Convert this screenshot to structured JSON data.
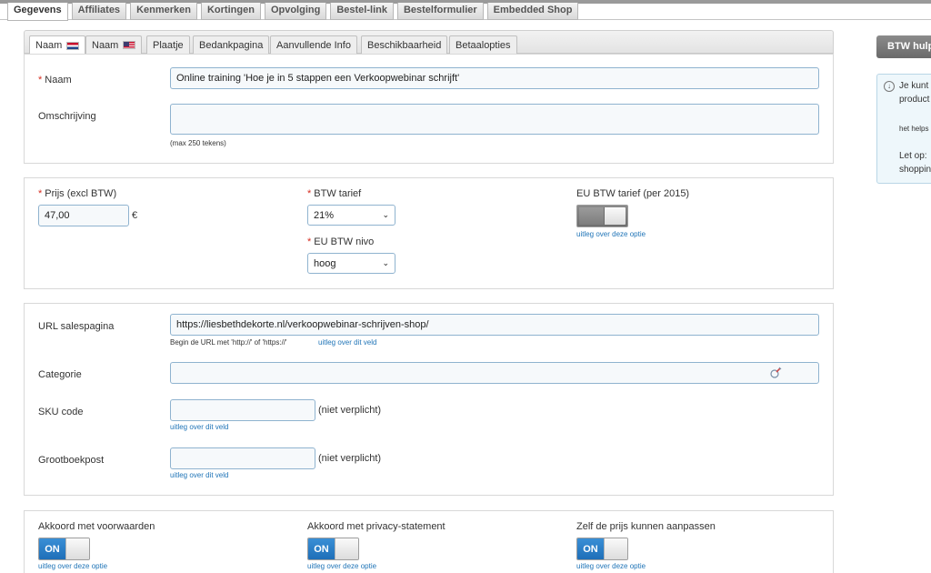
{
  "main_tabs": [
    "Gegevens",
    "Affiliates",
    "Kenmerken",
    "Kortingen",
    "Opvolging",
    "Bestel-link",
    "Bestelformulier",
    "Embedded Shop"
  ],
  "sub_tabs": [
    "Naam",
    "Naam",
    "Plaatje",
    "Bedankpagina",
    "Aanvullende Info",
    "Beschikbaarheid",
    "Betaalopties"
  ],
  "name_section": {
    "name_label": "Naam",
    "name_value": "Online training 'Hoe je in 5 stappen een Verkoopwebinar schrijft'",
    "description_label": "Omschrijving",
    "description_value": "",
    "description_hint": "(max 250 tekens)"
  },
  "price_section": {
    "price_label": "Prijs (excl BTW)",
    "price_value": "47,00",
    "currency": "€",
    "vat_rate_label": "BTW tarief",
    "vat_rate_value": "21%",
    "eu_vat_level_label": "EU BTW nivo",
    "eu_vat_level_value": "hoog",
    "eu_vat_rate_label": "EU BTW tarief (per 2015)",
    "eu_vat_rate_enabled": false,
    "eu_vat_rate_help": "uitleg over deze optie"
  },
  "url_section": {
    "url_label": "URL salespagina",
    "url_value": "https://liesbethdekorte.nl/verkoopwebinar-schrijven-shop/",
    "url_hint": "Begin de URL met 'http://' of 'https://'",
    "url_help": "uitleg over dit veld",
    "category_label": "Categorie",
    "category_value": "",
    "sku_label": "SKU code",
    "sku_value": "",
    "sku_note": "(niet verplicht)",
    "sku_help": "uitleg over dit veld",
    "ledger_label": "Grootboekpost",
    "ledger_value": "",
    "ledger_note": "(niet verplicht)",
    "ledger_help": "uitleg over dit veld"
  },
  "options_section": {
    "terms_label": "Akkoord met voorwaarden",
    "terms_toggle": "ON",
    "terms_help": "uitleg over deze optie",
    "privacy_label": "Akkoord met privacy-statement",
    "privacy_toggle": "ON",
    "privacy_help": "uitleg over deze optie",
    "custom_price_label": "Zelf de prijs kunnen aanpassen",
    "custom_price_toggle": "ON",
    "custom_price_help": "uitleg over deze optie"
  },
  "side_panel": {
    "btw_button": "BTW hulp",
    "help_line1": "Je kunt",
    "help_line2": "product",
    "help_line3": "het helps",
    "help_line4": "Let op:",
    "help_line5": "shopping"
  },
  "colors": {
    "accent_blue": "#1e6fb8",
    "required_red": "#d62d20",
    "field_border": "#8fb3cf",
    "help_bg": "#eef7fb"
  }
}
